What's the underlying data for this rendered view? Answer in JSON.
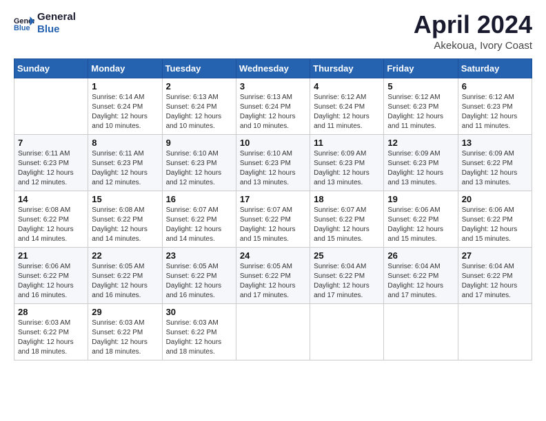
{
  "header": {
    "logo_line1": "General",
    "logo_line2": "Blue",
    "title": "April 2024",
    "subtitle": "Akekoua, Ivory Coast"
  },
  "calendar": {
    "days_of_week": [
      "Sunday",
      "Monday",
      "Tuesday",
      "Wednesday",
      "Thursday",
      "Friday",
      "Saturday"
    ],
    "weeks": [
      [
        {
          "day": "",
          "info": ""
        },
        {
          "day": "1",
          "info": "Sunrise: 6:14 AM\nSunset: 6:24 PM\nDaylight: 12 hours\nand 10 minutes."
        },
        {
          "day": "2",
          "info": "Sunrise: 6:13 AM\nSunset: 6:24 PM\nDaylight: 12 hours\nand 10 minutes."
        },
        {
          "day": "3",
          "info": "Sunrise: 6:13 AM\nSunset: 6:24 PM\nDaylight: 12 hours\nand 10 minutes."
        },
        {
          "day": "4",
          "info": "Sunrise: 6:12 AM\nSunset: 6:24 PM\nDaylight: 12 hours\nand 11 minutes."
        },
        {
          "day": "5",
          "info": "Sunrise: 6:12 AM\nSunset: 6:23 PM\nDaylight: 12 hours\nand 11 minutes."
        },
        {
          "day": "6",
          "info": "Sunrise: 6:12 AM\nSunset: 6:23 PM\nDaylight: 12 hours\nand 11 minutes."
        }
      ],
      [
        {
          "day": "7",
          "info": "Sunrise: 6:11 AM\nSunset: 6:23 PM\nDaylight: 12 hours\nand 12 minutes."
        },
        {
          "day": "8",
          "info": "Sunrise: 6:11 AM\nSunset: 6:23 PM\nDaylight: 12 hours\nand 12 minutes."
        },
        {
          "day": "9",
          "info": "Sunrise: 6:10 AM\nSunset: 6:23 PM\nDaylight: 12 hours\nand 12 minutes."
        },
        {
          "day": "10",
          "info": "Sunrise: 6:10 AM\nSunset: 6:23 PM\nDaylight: 12 hours\nand 13 minutes."
        },
        {
          "day": "11",
          "info": "Sunrise: 6:09 AM\nSunset: 6:23 PM\nDaylight: 12 hours\nand 13 minutes."
        },
        {
          "day": "12",
          "info": "Sunrise: 6:09 AM\nSunset: 6:23 PM\nDaylight: 12 hours\nand 13 minutes."
        },
        {
          "day": "13",
          "info": "Sunrise: 6:09 AM\nSunset: 6:22 PM\nDaylight: 12 hours\nand 13 minutes."
        }
      ],
      [
        {
          "day": "14",
          "info": "Sunrise: 6:08 AM\nSunset: 6:22 PM\nDaylight: 12 hours\nand 14 minutes."
        },
        {
          "day": "15",
          "info": "Sunrise: 6:08 AM\nSunset: 6:22 PM\nDaylight: 12 hours\nand 14 minutes."
        },
        {
          "day": "16",
          "info": "Sunrise: 6:07 AM\nSunset: 6:22 PM\nDaylight: 12 hours\nand 14 minutes."
        },
        {
          "day": "17",
          "info": "Sunrise: 6:07 AM\nSunset: 6:22 PM\nDaylight: 12 hours\nand 15 minutes."
        },
        {
          "day": "18",
          "info": "Sunrise: 6:07 AM\nSunset: 6:22 PM\nDaylight: 12 hours\nand 15 minutes."
        },
        {
          "day": "19",
          "info": "Sunrise: 6:06 AM\nSunset: 6:22 PM\nDaylight: 12 hours\nand 15 minutes."
        },
        {
          "day": "20",
          "info": "Sunrise: 6:06 AM\nSunset: 6:22 PM\nDaylight: 12 hours\nand 15 minutes."
        }
      ],
      [
        {
          "day": "21",
          "info": "Sunrise: 6:06 AM\nSunset: 6:22 PM\nDaylight: 12 hours\nand 16 minutes."
        },
        {
          "day": "22",
          "info": "Sunrise: 6:05 AM\nSunset: 6:22 PM\nDaylight: 12 hours\nand 16 minutes."
        },
        {
          "day": "23",
          "info": "Sunrise: 6:05 AM\nSunset: 6:22 PM\nDaylight: 12 hours\nand 16 minutes."
        },
        {
          "day": "24",
          "info": "Sunrise: 6:05 AM\nSunset: 6:22 PM\nDaylight: 12 hours\nand 17 minutes."
        },
        {
          "day": "25",
          "info": "Sunrise: 6:04 AM\nSunset: 6:22 PM\nDaylight: 12 hours\nand 17 minutes."
        },
        {
          "day": "26",
          "info": "Sunrise: 6:04 AM\nSunset: 6:22 PM\nDaylight: 12 hours\nand 17 minutes."
        },
        {
          "day": "27",
          "info": "Sunrise: 6:04 AM\nSunset: 6:22 PM\nDaylight: 12 hours\nand 17 minutes."
        }
      ],
      [
        {
          "day": "28",
          "info": "Sunrise: 6:03 AM\nSunset: 6:22 PM\nDaylight: 12 hours\nand 18 minutes."
        },
        {
          "day": "29",
          "info": "Sunrise: 6:03 AM\nSunset: 6:22 PM\nDaylight: 12 hours\nand 18 minutes."
        },
        {
          "day": "30",
          "info": "Sunrise: 6:03 AM\nSunset: 6:22 PM\nDaylight: 12 hours\nand 18 minutes."
        },
        {
          "day": "",
          "info": ""
        },
        {
          "day": "",
          "info": ""
        },
        {
          "day": "",
          "info": ""
        },
        {
          "day": "",
          "info": ""
        }
      ]
    ]
  }
}
